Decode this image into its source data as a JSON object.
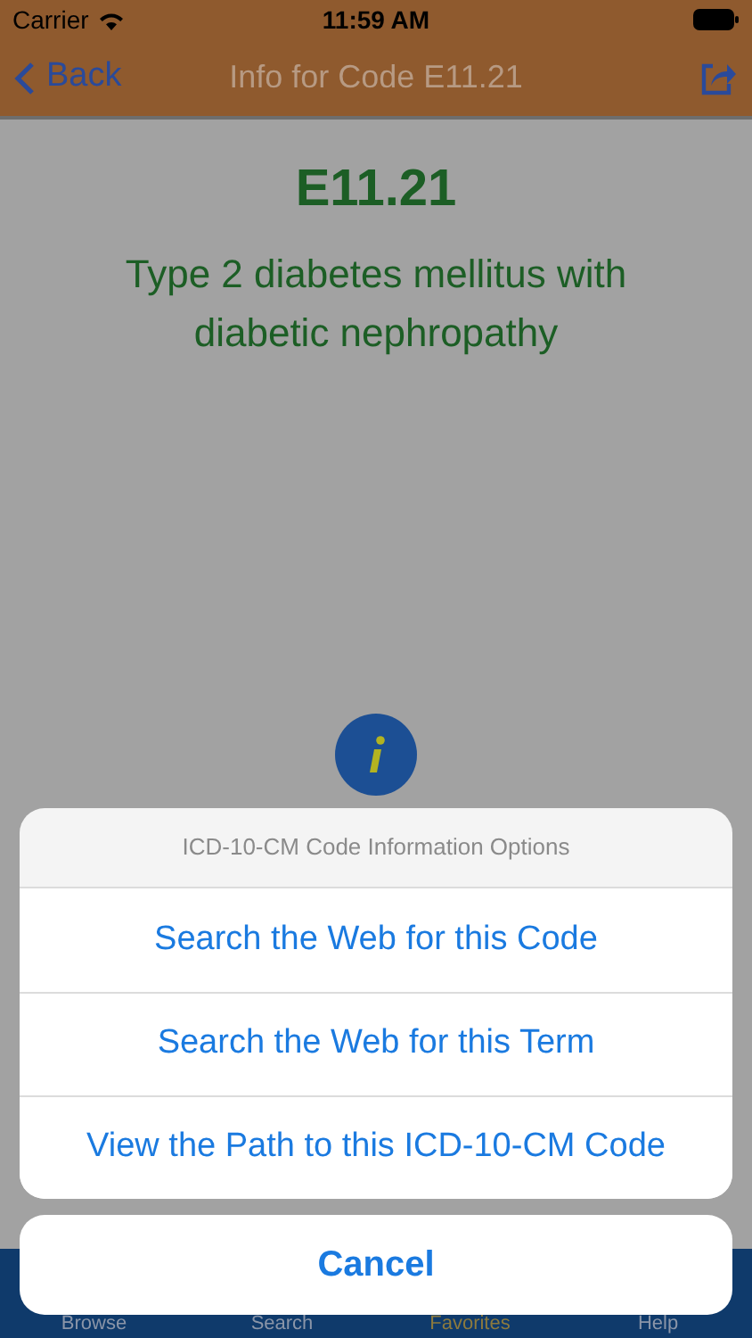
{
  "status_bar": {
    "carrier": "Carrier",
    "time": "11:59 AM"
  },
  "nav": {
    "back": "Back",
    "title": "Info for Code E11.21"
  },
  "code": "E11.21",
  "description": "Type 2 diabetes mellitus with diabetic nephropathy",
  "tabs": [
    {
      "label": "Browse",
      "selected": false
    },
    {
      "label": "Search",
      "selected": false
    },
    {
      "label": "Favorites",
      "selected": true
    },
    {
      "label": "Help",
      "selected": false
    }
  ],
  "action_sheet": {
    "title": "ICD-10-CM Code Information Options",
    "options": [
      "Search the Web for this Code",
      "Search the Web for this Term",
      "View the Path to this ICD-10-CM Code"
    ],
    "cancel": "Cancel"
  }
}
